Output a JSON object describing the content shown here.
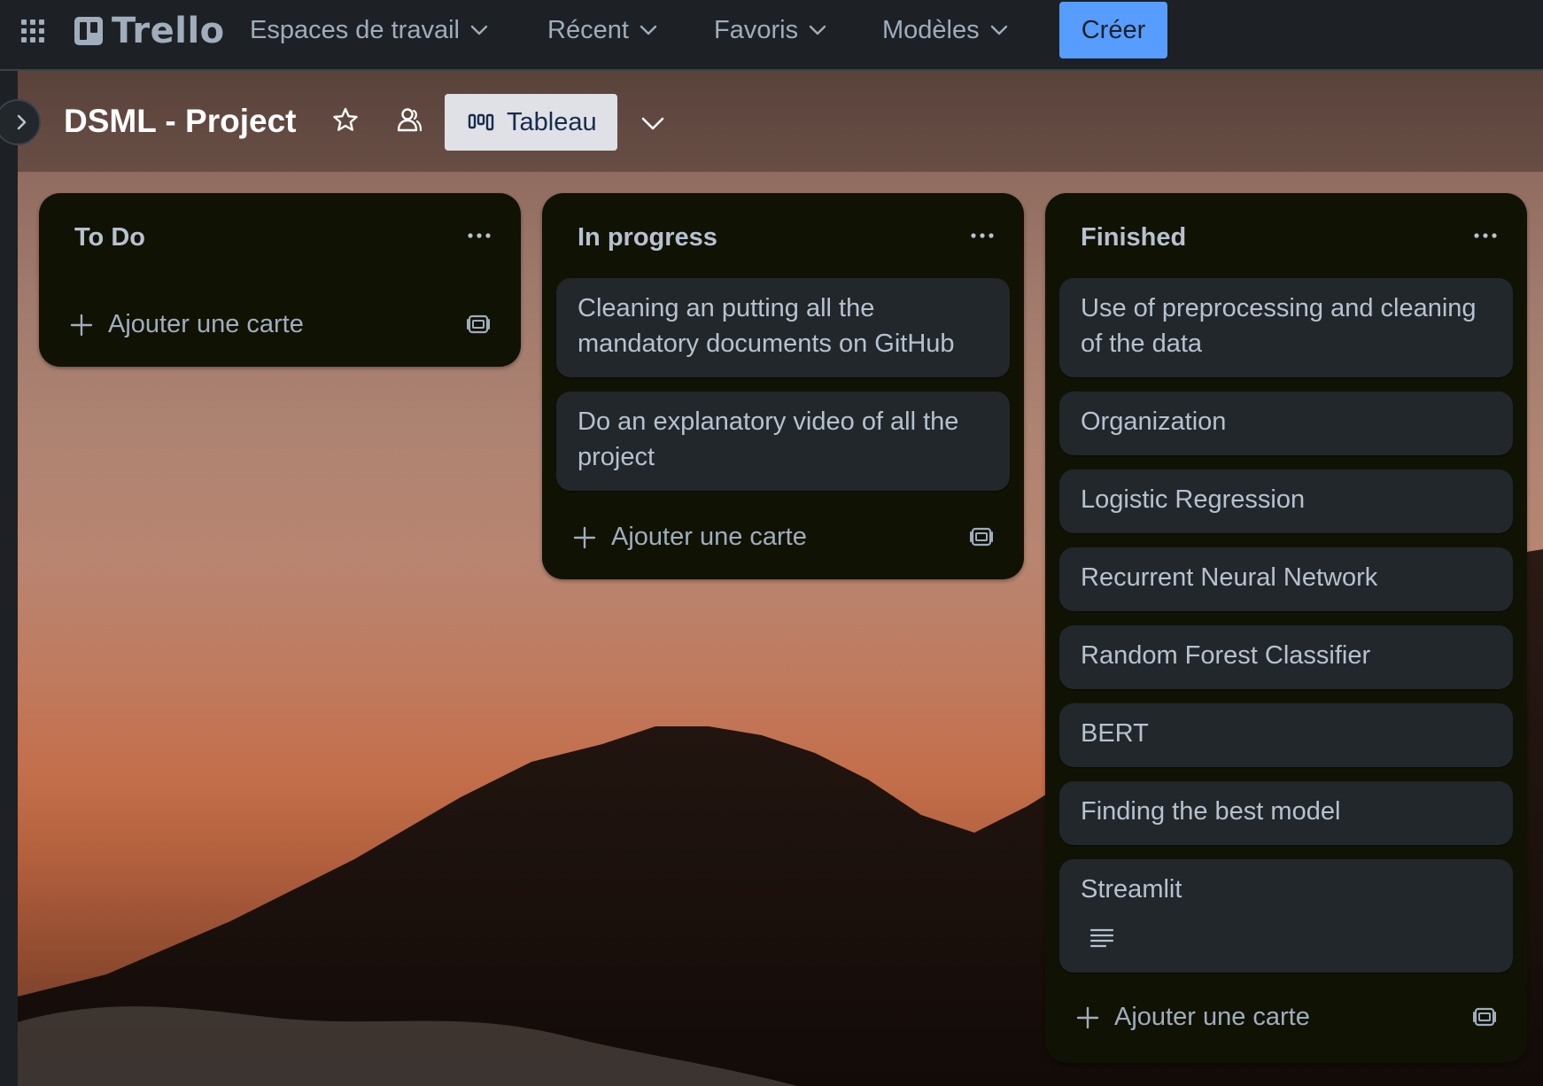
{
  "topbar": {
    "logo_text": "Trello",
    "menus": [
      {
        "label": "Espaces de travail"
      },
      {
        "label": "Récent"
      },
      {
        "label": "Favoris"
      },
      {
        "label": "Modèles"
      }
    ],
    "create_label": "Créer"
  },
  "board": {
    "title": "DSML - Project",
    "view_label": "Tableau"
  },
  "lists": [
    {
      "title": "To Do",
      "cards": [],
      "add_card_label": "Ajouter une carte"
    },
    {
      "title": "In progress",
      "cards": [
        {
          "title": "Cleaning an putting all the mandatory documents on GitHub"
        },
        {
          "title": "Do an explanatory video of all the project"
        }
      ],
      "add_card_label": "Ajouter une carte"
    },
    {
      "title": "Finished",
      "cards": [
        {
          "title": "Use of preprocessing and cleaning of the data"
        },
        {
          "title": "Organization"
        },
        {
          "title": "Logistic Regression"
        },
        {
          "title": "Recurrent Neural Network"
        },
        {
          "title": "Random Forest Classifier"
        },
        {
          "title": "BERT"
        },
        {
          "title": "Finding the best model"
        },
        {
          "title": "Streamlit",
          "has_description": true
        }
      ],
      "add_card_label": "Ajouter une carte"
    }
  ],
  "colors": {
    "create_button": "#579dff",
    "list_background": "#101204",
    "card_background": "#22272b",
    "topbar_background": "#1d2125"
  },
  "icons": {
    "apps": "apps-grid-icon",
    "star": "star-icon",
    "members": "members-icon",
    "board_view": "board-columns-icon",
    "list_menu": "more-horizontal-icon",
    "add": "plus-icon",
    "template": "card-template-icon",
    "description": "description-icon"
  }
}
